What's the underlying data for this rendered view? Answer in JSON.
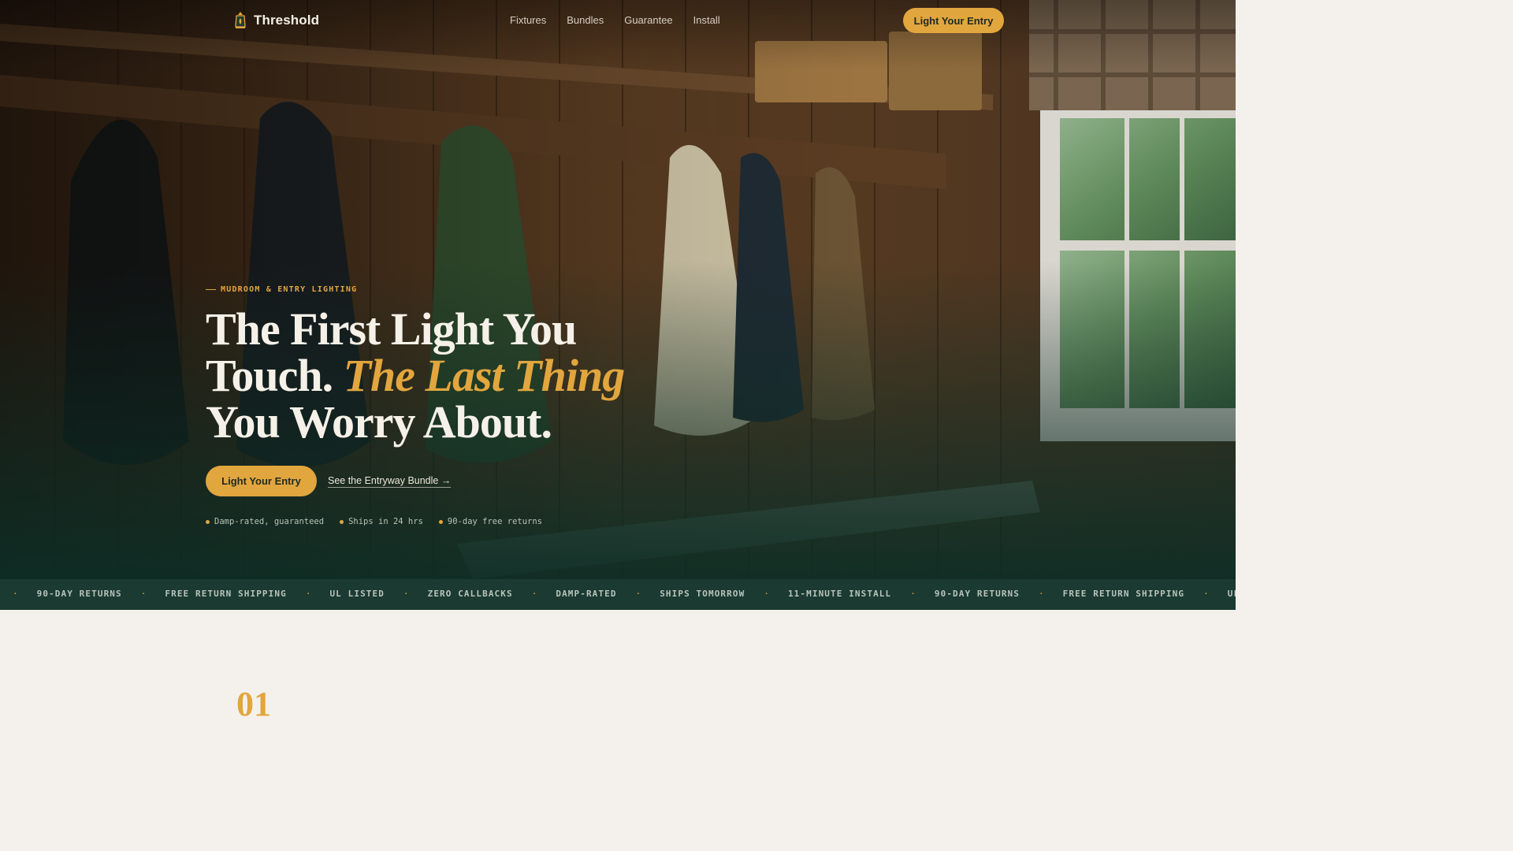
{
  "colors": {
    "accent": "#e2a63e",
    "dark_green": "#1b3a31",
    "page_bg": "#f4f1ec",
    "cream_text": "#f6f1e8"
  },
  "nav": {
    "brand_icon": "lantern-icon",
    "brand_name": "Threshold",
    "links": [
      "Fixtures",
      "Bundles",
      "Guarantee",
      "Install"
    ],
    "cta_label": "Light Your Entry"
  },
  "hero": {
    "eyebrow": "MUDROOM & ENTRY LIGHTING",
    "headline_line1": "The First Light You",
    "headline_line2_plain": "Touch.",
    "headline_line2_accent": "The Last Thing",
    "headline_line3": "You Worry About.",
    "primary_button": "Light Your Entry",
    "secondary_link": "See the Entryway Bundle →",
    "trust_items": [
      "Damp-rated, guaranteed",
      "Ships in 24 hrs",
      "90-day free returns"
    ]
  },
  "marquee": {
    "items": [
      "90-DAY RETURNS",
      "FREE RETURN SHIPPING",
      "UL LISTED",
      "ZERO CALLBACKS",
      "DAMP-RATED",
      "SHIPS TOMORROW",
      "11-MINUTE INSTALL",
      "90-DAY RETURNS",
      "FREE RETURN SHIPPING",
      "UL LISTED"
    ],
    "separator": "·"
  },
  "next_section": {
    "number": "01"
  }
}
